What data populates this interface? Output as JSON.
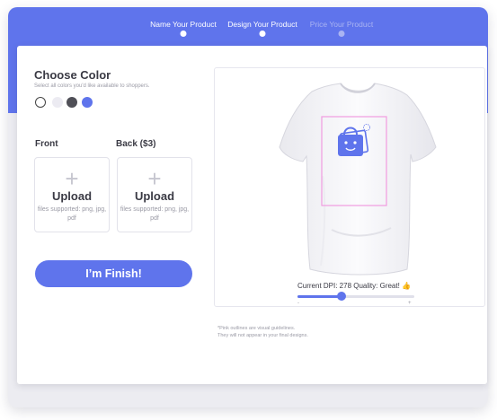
{
  "steps": [
    {
      "label": "Name Your Product",
      "state": "done"
    },
    {
      "label": "Design Your Product",
      "state": "current"
    },
    {
      "label": "Price Your Product",
      "state": "upcoming"
    }
  ],
  "colors_section": {
    "title": "Choose Color",
    "subtitle": "Select all colors you'd like available to shoppers.",
    "swatches": [
      {
        "name": "white",
        "hex": "#ffffff",
        "selected": true
      },
      {
        "name": "light-gray",
        "hex": "#ecebf2",
        "selected": false
      },
      {
        "name": "dark-gray",
        "hex": "#4f4f57",
        "selected": false
      },
      {
        "name": "blue",
        "hex": "#5f74ec",
        "selected": false
      }
    ]
  },
  "uploads": {
    "front": {
      "label": "Front",
      "title": "Upload",
      "hint": "files supported: png, jpg, pdf"
    },
    "back": {
      "label": "Back ($3)",
      "title": "Upload",
      "hint": "files supported: png, jpg, pdf"
    }
  },
  "finish_button": "I’m Finish!",
  "preview": {
    "dpi_text": "Current DPI: 278  Quality: Great! 👍",
    "slider_value": 0.38,
    "slider_min_label": "-",
    "slider_max_label": "+",
    "note_line1": "*Pink outlines are visual guidelines.",
    "note_line2": "They will not appear in your final designs."
  },
  "theme": {
    "accent": "#5f74ec",
    "guide": "#f19be0"
  }
}
